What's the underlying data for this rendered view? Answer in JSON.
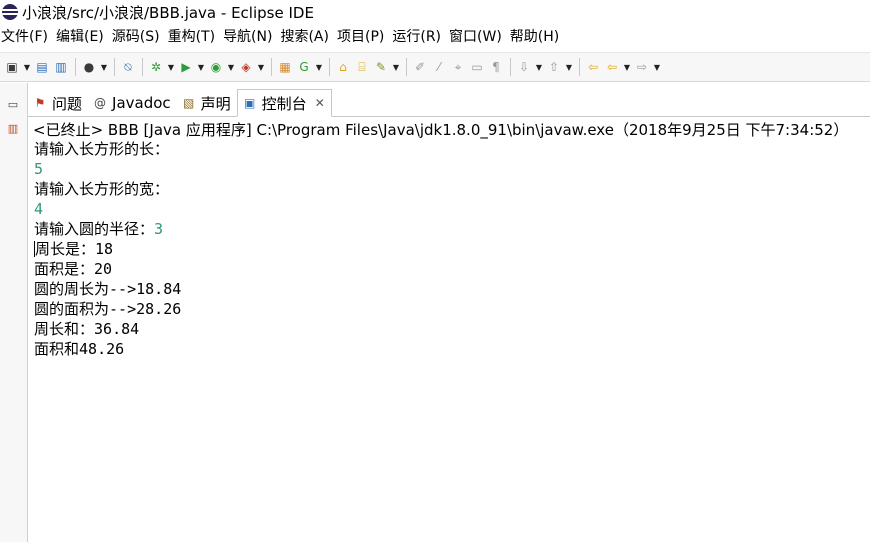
{
  "window": {
    "title": "小浪浪/src/小浪浪/BBB.java - Eclipse IDE"
  },
  "menu": [
    "文件(F)",
    "编辑(E)",
    "源码(S)",
    "重构(T)",
    "导航(N)",
    "搜索(A)",
    "项目(P)",
    "运行(R)",
    "窗口(W)",
    "帮助(H)"
  ],
  "tabs": {
    "problems": "问题",
    "javadoc": "Javadoc",
    "declaration": "声明",
    "console": "控制台",
    "close": "✕"
  },
  "console": {
    "header": "<已终止> BBB [Java 应用程序] C:\\Program Files\\Java\\jdk1.8.0_91\\bin\\javaw.exe（2018年9月25日 下午7:34:52）",
    "lines": {
      "prompt_length": "请输入长方形的长：",
      "input_length": "5",
      "prompt_width": "请输入长方形的宽：",
      "input_width": "4",
      "prompt_radius": "请输入圆的半径：",
      "input_radius": "3",
      "perimeter_label": "周长是：",
      "perimeter_value": "18",
      "area_label": "面积是：",
      "area_value": "20",
      "circle_perimeter_label": "圆的周长为",
      "circle_perimeter_value": "-->18.84",
      "circle_area_label": "圆的面积为",
      "circle_area_value": "-->28.26",
      "perimeter_sum_label": "周长和：",
      "perimeter_sum_value": "36.84",
      "area_sum_label": "面积和",
      "area_sum_value": "48.26"
    }
  },
  "colors": {
    "user_input": "#2f9a6b"
  }
}
